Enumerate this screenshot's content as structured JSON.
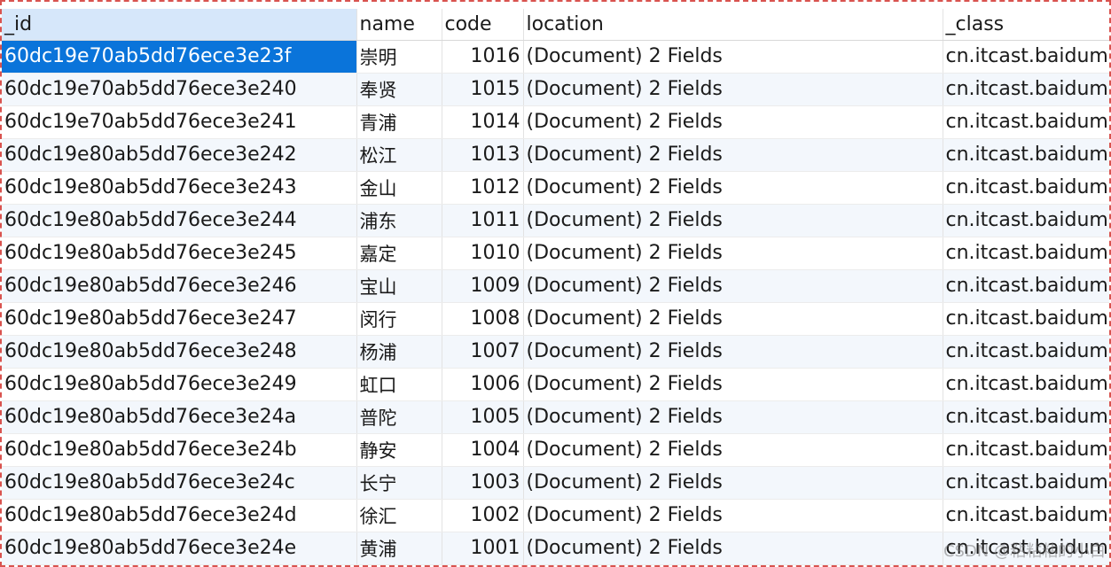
{
  "columns": [
    "_id",
    "name",
    "code",
    "location",
    "_class"
  ],
  "rows": [
    {
      "id": "60dc19e70ab5dd76ece3e23f",
      "name": "崇明",
      "code": "1016",
      "location": "(Document) 2 Fields",
      "class": "cn.itcast.baiduma"
    },
    {
      "id": "60dc19e70ab5dd76ece3e240",
      "name": "奉贤",
      "code": "1015",
      "location": "(Document) 2 Fields",
      "class": "cn.itcast.baiduma"
    },
    {
      "id": "60dc19e70ab5dd76ece3e241",
      "name": "青浦",
      "code": "1014",
      "location": "(Document) 2 Fields",
      "class": "cn.itcast.baiduma"
    },
    {
      "id": "60dc19e80ab5dd76ece3e242",
      "name": "松江",
      "code": "1013",
      "location": "(Document) 2 Fields",
      "class": "cn.itcast.baiduma"
    },
    {
      "id": "60dc19e80ab5dd76ece3e243",
      "name": "金山",
      "code": "1012",
      "location": "(Document) 2 Fields",
      "class": "cn.itcast.baiduma"
    },
    {
      "id": "60dc19e80ab5dd76ece3e244",
      "name": "浦东",
      "code": "1011",
      "location": "(Document) 2 Fields",
      "class": "cn.itcast.baiduma"
    },
    {
      "id": "60dc19e80ab5dd76ece3e245",
      "name": "嘉定",
      "code": "1010",
      "location": "(Document) 2 Fields",
      "class": "cn.itcast.baiduma"
    },
    {
      "id": "60dc19e80ab5dd76ece3e246",
      "name": "宝山",
      "code": "1009",
      "location": "(Document) 2 Fields",
      "class": "cn.itcast.baiduma"
    },
    {
      "id": "60dc19e80ab5dd76ece3e247",
      "name": "闵行",
      "code": "1008",
      "location": "(Document) 2 Fields",
      "class": "cn.itcast.baiduma"
    },
    {
      "id": "60dc19e80ab5dd76ece3e248",
      "name": "杨浦",
      "code": "1007",
      "location": "(Document) 2 Fields",
      "class": "cn.itcast.baiduma"
    },
    {
      "id": "60dc19e80ab5dd76ece3e249",
      "name": "虹口",
      "code": "1006",
      "location": "(Document) 2 Fields",
      "class": "cn.itcast.baiduma"
    },
    {
      "id": "60dc19e80ab5dd76ece3e24a",
      "name": "普陀",
      "code": "1005",
      "location": "(Document) 2 Fields",
      "class": "cn.itcast.baiduma"
    },
    {
      "id": "60dc19e80ab5dd76ece3e24b",
      "name": "静安",
      "code": "1004",
      "location": "(Document) 2 Fields",
      "class": "cn.itcast.baiduma"
    },
    {
      "id": "60dc19e80ab5dd76ece3e24c",
      "name": "长宁",
      "code": "1003",
      "location": "(Document) 2 Fields",
      "class": "cn.itcast.baiduma"
    },
    {
      "id": "60dc19e80ab5dd76ece3e24d",
      "name": "徐汇",
      "code": "1002",
      "location": "(Document) 2 Fields",
      "class": "cn.itcast.baiduma"
    },
    {
      "id": "60dc19e80ab5dd76ece3e24e",
      "name": "黄浦",
      "code": "1001",
      "location": "(Document) 2 Fields",
      "class": "cn.itcast.baidume"
    }
  ],
  "selected_row": 0,
  "watermark": "CSDN @粘粘粘的小白",
  "colors": {
    "selection": "#0a74da",
    "sorted_header": "#d6e7fa",
    "alt_row": "#f3f7fc",
    "frame_border": "#d9534f"
  }
}
